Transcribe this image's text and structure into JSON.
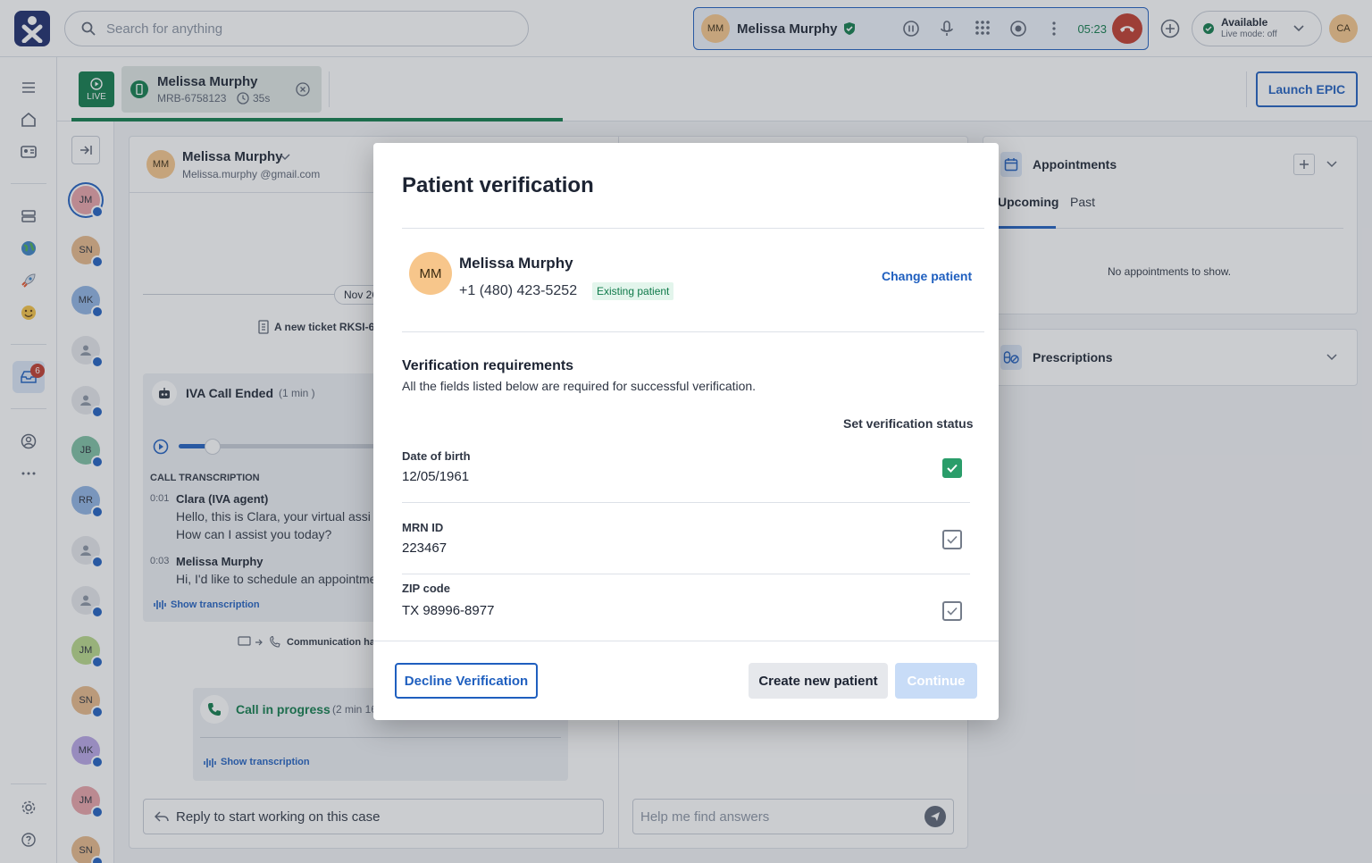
{
  "topbar": {
    "search_placeholder": "Search for anything",
    "call": {
      "avatar": "MM",
      "name": "Melissa Murphy",
      "timer": "05:23"
    },
    "status": {
      "title": "Available",
      "subtitle": "Live mode: off"
    },
    "user_avatar": "CA"
  },
  "sidenav": {
    "notification_count": "6"
  },
  "case_tab": {
    "live": "LIVE",
    "name": "Melissa Murphy",
    "mrn": "MRB-6758123",
    "elapsed": "35s",
    "progress": 0.55
  },
  "launch_epic": "Launch EPIC",
  "queue": [
    "JM",
    "SN",
    "MK",
    "",
    "",
    "JB",
    "RR",
    "",
    "",
    "JM",
    "SN",
    "MK",
    "JM",
    "SN"
  ],
  "conversation": {
    "avatar": "MM",
    "name": "Melissa Murphy",
    "email": "Melissa.murphy @gmail.com",
    "date": "Nov 26",
    "ticket": "A new ticket RKSI-667",
    "iva_title": "IVA Call Ended",
    "iva_duration": "(1 min )",
    "transcription_label": "CALL TRANSCRIPTION",
    "lines": [
      {
        "time": "0:01",
        "speaker": "Clara (IVA agent)",
        "text1": "Hello, this is Clara, your virtual assi",
        "text2": "How can I assist you today?"
      },
      {
        "time": "0:03",
        "speaker": "Melissa Murphy",
        "text1": "Hi, I'd like to schedule an appointme",
        "text2": ""
      }
    ],
    "show_transcription": "Show transcription",
    "channel_change": "Communication ha",
    "call_title": "Call in progress",
    "call_duration": "(2 min 16",
    "show_transcription_2": "Show transcription",
    "reply_placeholder": "Reply to start working on this case"
  },
  "assist": {
    "placeholder": "Help me find answers"
  },
  "right": {
    "appointments": "Appointments",
    "tab_upcoming": "Upcoming",
    "tab_past": "Past",
    "empty": "No appointments to show.",
    "prescriptions": "Prescriptions"
  },
  "modal": {
    "title": "Patient verification",
    "patient": {
      "avatar": "MM",
      "name": "Melissa Murphy",
      "phone": "+1 (480) 423-5252",
      "badge": "Existing patient"
    },
    "change_patient": "Change patient",
    "req_title": "Verification requirements",
    "req_subtitle": "All the fields listed below are required for successful verification.",
    "status_header": "Set verification status",
    "fields": [
      {
        "label": "Date of birth",
        "value": "12/05/1961",
        "verified": true
      },
      {
        "label": "MRN ID",
        "value": "223467",
        "verified": false
      },
      {
        "label": "ZIP code",
        "value": "TX 98996-8977",
        "verified": false
      }
    ],
    "decline": "Decline Verification",
    "create": "Create new patient",
    "continue": "Continue"
  },
  "colors": {
    "primary": "#1f5fbf",
    "success": "#2a9d6a",
    "live": "#0f7a4a",
    "danger": "#c0392b"
  }
}
